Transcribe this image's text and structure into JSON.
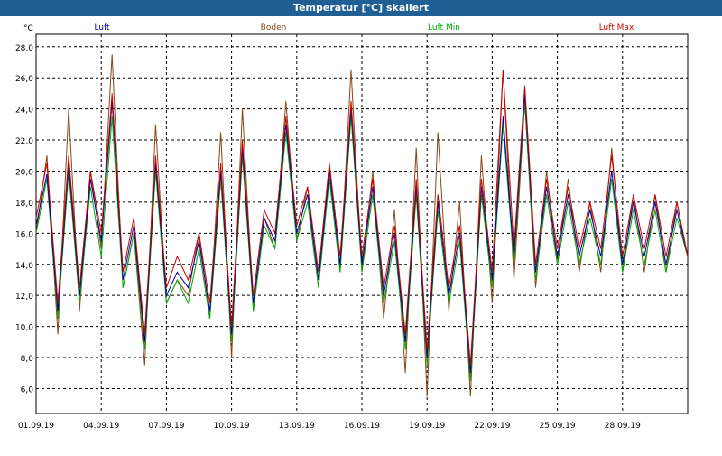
{
  "window": {
    "title": "Temperatur [°C] skaliert"
  },
  "chart_data": {
    "type": "line",
    "title": "Temperatur [°C] skaliert",
    "ylabel": "°C",
    "xlabel": "",
    "ylim": [
      4.4,
      28.8
    ],
    "xlim": [
      "2019-09-01",
      "2019-10-01"
    ],
    "yticks": [
      6,
      8,
      10,
      12,
      14,
      16,
      18,
      20,
      22,
      24,
      26,
      28
    ],
    "ytick_labels": [
      "6,0",
      "8,0",
      "10,0",
      "12,0",
      "14,0",
      "16,0",
      "18,0",
      "20,0",
      "22,0",
      "24,0",
      "26,0",
      "28,0"
    ],
    "xticks": [
      "2019-09-01",
      "2019-09-04",
      "2019-09-07",
      "2019-09-10",
      "2019-09-13",
      "2019-09-16",
      "2019-09-19",
      "2019-09-22",
      "2019-09-25",
      "2019-09-28"
    ],
    "xtick_labels": [
      "01.09.19",
      "04.09.19",
      "07.09.19",
      "10.09.19",
      "13.09.19",
      "16.09.19",
      "19.09.19",
      "22.09.19",
      "25.09.19",
      "28.09.19"
    ],
    "grid": true,
    "legend_position": "top",
    "x": [
      "2019-09-01 00:00",
      "2019-09-01 12:00",
      "2019-09-02 00:00",
      "2019-09-02 12:00",
      "2019-09-03 00:00",
      "2019-09-03 12:00",
      "2019-09-04 00:00",
      "2019-09-04 12:00",
      "2019-09-05 00:00",
      "2019-09-05 12:00",
      "2019-09-06 00:00",
      "2019-09-06 12:00",
      "2019-09-07 00:00",
      "2019-09-07 12:00",
      "2019-09-08 00:00",
      "2019-09-08 12:00",
      "2019-09-09 00:00",
      "2019-09-09 12:00",
      "2019-09-10 00:00",
      "2019-09-10 12:00",
      "2019-09-11 00:00",
      "2019-09-11 12:00",
      "2019-09-12 00:00",
      "2019-09-12 12:00",
      "2019-09-13 00:00",
      "2019-09-13 12:00",
      "2019-09-14 00:00",
      "2019-09-14 12:00",
      "2019-09-15 00:00",
      "2019-09-15 12:00",
      "2019-09-16 00:00",
      "2019-09-16 12:00",
      "2019-09-17 00:00",
      "2019-09-17 12:00",
      "2019-09-18 00:00",
      "2019-09-18 12:00",
      "2019-09-19 00:00",
      "2019-09-19 12:00",
      "2019-09-20 00:00",
      "2019-09-20 12:00",
      "2019-09-21 00:00",
      "2019-09-21 12:00",
      "2019-09-22 00:00",
      "2019-09-22 12:00",
      "2019-09-23 00:00",
      "2019-09-23 12:00",
      "2019-09-24 00:00",
      "2019-09-24 12:00",
      "2019-09-25 00:00",
      "2019-09-25 12:00",
      "2019-09-26 00:00",
      "2019-09-26 12:00",
      "2019-09-27 00:00",
      "2019-09-27 12:00",
      "2019-09-28 00:00",
      "2019-09-28 12:00",
      "2019-09-29 00:00",
      "2019-09-29 12:00",
      "2019-09-30 00:00",
      "2019-09-30 12:00",
      "2019-10-01 00:00"
    ],
    "series": [
      {
        "name": "Luft",
        "color": "#0000aa",
        "values": [
          16.5,
          19.8,
          11.0,
          20.5,
          12.0,
          19.5,
          15.5,
          24.5,
          13.0,
          16.5,
          9.0,
          20.5,
          12.0,
          13.5,
          12.5,
          15.5,
          11.0,
          20.0,
          9.5,
          21.5,
          11.5,
          17.0,
          15.5,
          23.0,
          16.0,
          18.5,
          13.0,
          20.0,
          14.0,
          24.0,
          14.0,
          19.0,
          12.0,
          16.0,
          9.0,
          19.0,
          8.0,
          18.0,
          12.0,
          16.0,
          7.0,
          19.0,
          13.0,
          23.5,
          14.5,
          25.0,
          13.5,
          19.0,
          14.5,
          18.5,
          14.5,
          17.5,
          14.5,
          20.0,
          14.0,
          18.0,
          14.5,
          18.0,
          14.0,
          17.5,
          14.5
        ]
      },
      {
        "name": "Boden",
        "color": "#8b4513",
        "values": [
          16.0,
          21.0,
          9.5,
          24.0,
          11.0,
          20.0,
          15.0,
          27.5,
          12.5,
          16.0,
          7.5,
          23.0,
          11.5,
          13.0,
          12.0,
          16.0,
          10.5,
          22.5,
          8.0,
          24.0,
          11.0,
          17.0,
          15.0,
          24.5,
          15.5,
          19.0,
          12.5,
          20.5,
          13.5,
          26.5,
          13.5,
          20.0,
          10.5,
          17.5,
          7.0,
          21.5,
          5.5,
          22.5,
          11.0,
          18.0,
          5.5,
          21.0,
          11.5,
          26.5,
          13.0,
          24.5,
          12.5,
          20.0,
          14.0,
          19.5,
          13.5,
          18.0,
          13.5,
          21.5,
          13.5,
          18.5,
          13.5,
          18.5,
          13.5,
          18.0,
          14.5
        ]
      },
      {
        "name": "Luft Min",
        "color": "#00aa00",
        "values": [
          16.0,
          19.5,
          10.5,
          20.0,
          11.5,
          19.0,
          14.5,
          23.5,
          12.5,
          16.0,
          8.5,
          20.0,
          11.5,
          13.0,
          11.5,
          15.0,
          10.5,
          19.5,
          9.0,
          21.0,
          11.0,
          16.5,
          15.0,
          22.5,
          15.5,
          18.0,
          12.5,
          19.5,
          13.5,
          23.5,
          13.5,
          18.5,
          11.5,
          15.5,
          8.5,
          18.5,
          7.5,
          17.5,
          11.5,
          15.5,
          6.5,
          18.5,
          12.5,
          23.0,
          14.0,
          24.5,
          13.0,
          18.5,
          14.0,
          18.0,
          14.0,
          17.0,
          14.0,
          19.5,
          13.5,
          17.5,
          14.0,
          17.5,
          13.5,
          17.0,
          14.5
        ]
      },
      {
        "name": "Luft Max",
        "color": "#cc0000",
        "values": [
          17.0,
          20.5,
          11.5,
          21.0,
          12.5,
          20.0,
          16.0,
          25.0,
          13.5,
          17.0,
          9.5,
          21.0,
          12.5,
          14.5,
          13.0,
          16.0,
          11.5,
          20.5,
          10.0,
          22.0,
          12.0,
          17.5,
          16.0,
          23.5,
          16.5,
          19.0,
          13.5,
          20.5,
          14.5,
          24.5,
          14.5,
          19.5,
          12.5,
          16.5,
          9.5,
          19.5,
          8.5,
          18.5,
          12.5,
          16.5,
          7.5,
          19.5,
          13.5,
          26.5,
          15.0,
          25.5,
          14.0,
          19.5,
          15.0,
          19.0,
          15.0,
          18.0,
          15.0,
          21.0,
          14.5,
          18.5,
          15.0,
          18.5,
          14.5,
          18.0,
          14.5
        ]
      }
    ]
  }
}
